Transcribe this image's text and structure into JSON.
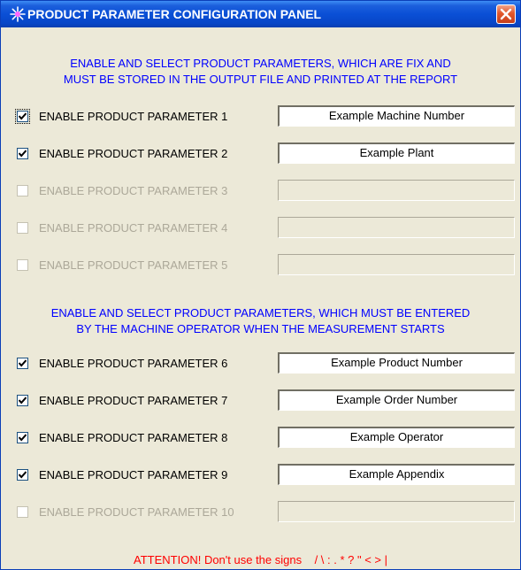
{
  "window": {
    "title": "PRODUCT PARAMETER CONFIGURATION PANEL",
    "icon": "sparkle-icon",
    "close_icon": "close-icon"
  },
  "section1": {
    "heading_line1": "ENABLE AND SELECT PRODUCT PARAMETERS, WHICH ARE FIX AND",
    "heading_line2": "MUST BE STORED IN THE OUTPUT FILE AND PRINTED AT THE REPORT"
  },
  "section2": {
    "heading_line1": "ENABLE AND SELECT PRODUCT PARAMETERS, WHICH MUST BE ENTERED",
    "heading_line2": "BY THE MACHINE OPERATOR WHEN THE MEASUREMENT STARTS"
  },
  "params": [
    {
      "label": "ENABLE PRODUCT PARAMETER 1",
      "checked": true,
      "enabled": true,
      "value": "Example Machine Number"
    },
    {
      "label": "ENABLE PRODUCT PARAMETER 2",
      "checked": true,
      "enabled": true,
      "value": "Example Plant"
    },
    {
      "label": "ENABLE PRODUCT PARAMETER 3",
      "checked": false,
      "enabled": false,
      "value": ""
    },
    {
      "label": "ENABLE PRODUCT PARAMETER 4",
      "checked": false,
      "enabled": false,
      "value": ""
    },
    {
      "label": "ENABLE PRODUCT PARAMETER 5",
      "checked": false,
      "enabled": false,
      "value": ""
    },
    {
      "label": "ENABLE PRODUCT PARAMETER 6",
      "checked": true,
      "enabled": true,
      "value": "Example Product Number"
    },
    {
      "label": "ENABLE PRODUCT PARAMETER 7",
      "checked": true,
      "enabled": true,
      "value": "Example Order Number"
    },
    {
      "label": "ENABLE PRODUCT PARAMETER 8",
      "checked": true,
      "enabled": true,
      "value": "Example Operator"
    },
    {
      "label": "ENABLE PRODUCT PARAMETER 9",
      "checked": true,
      "enabled": true,
      "value": "Example Appendix"
    },
    {
      "label": "ENABLE PRODUCT PARAMETER 10",
      "checked": false,
      "enabled": false,
      "value": ""
    }
  ],
  "attention": {
    "text": "ATTENTION! Don't use the signs",
    "signs": "/  \\  :  .  *  ?  \"  <  >  |"
  },
  "colors": {
    "heading": "#0000ff",
    "attention": "#ff0000",
    "titlebar": "#0a4fd6",
    "disabled_text": "#aca899"
  }
}
